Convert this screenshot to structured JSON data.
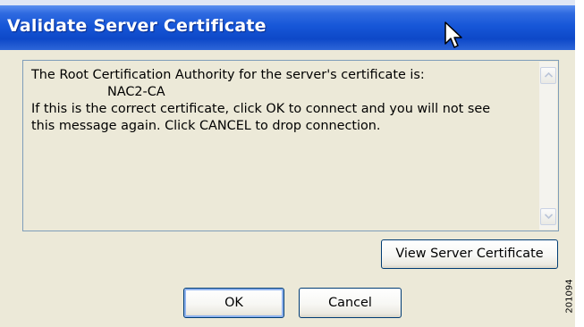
{
  "dialog": {
    "title": "Validate Server Certificate",
    "message_lines": [
      "The Root Certification Authority for the server's certificate is:",
      "NAC2-CA",
      "If this is the correct certificate, click OK to connect and you will not see",
      "this message again.  Click CANCEL to drop connection."
    ],
    "view_certificate_label": "View Server Certificate",
    "ok_label": "OK",
    "cancel_label": "Cancel"
  },
  "figure_number": "201094",
  "colors": {
    "titlebar": "#0d48c8",
    "dialog_background": "#ece9d8",
    "button_border": "#003c74"
  }
}
